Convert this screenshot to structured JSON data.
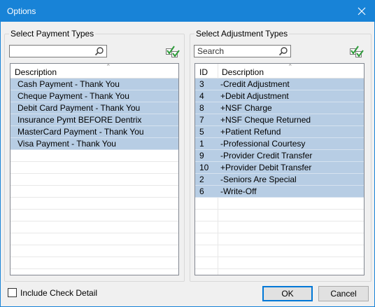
{
  "window": {
    "title": "Options"
  },
  "payment": {
    "group_label": "Select Payment Types",
    "search_value": "",
    "search_placeholder": "",
    "columns": [
      "Description"
    ],
    "rows": [
      {
        "description": "Cash Payment - Thank You",
        "selected": true
      },
      {
        "description": "Cheque Payment - Thank You",
        "selected": true
      },
      {
        "description": "Debit Card Payment - Thank You",
        "selected": true
      },
      {
        "description": "Insurance Pymt BEFORE Dentrix",
        "selected": true
      },
      {
        "description": "MasterCard Payment - Thank You",
        "selected": true
      },
      {
        "description": "Visa Payment - Thank You",
        "selected": true
      }
    ]
  },
  "adjustment": {
    "group_label": "Select Adjustment Types",
    "search_value": "",
    "search_placeholder": "Search",
    "columns": [
      "ID",
      "Description"
    ],
    "rows": [
      {
        "id": "3",
        "description": "-Credit Adjustment",
        "selected": true
      },
      {
        "id": "4",
        "description": "+Debit Adjustment",
        "selected": true
      },
      {
        "id": "8",
        "description": "+NSF Charge",
        "selected": true
      },
      {
        "id": "7",
        "description": "+NSF Cheque Returned",
        "selected": true
      },
      {
        "id": "5",
        "description": "+Patient Refund",
        "selected": true
      },
      {
        "id": "1",
        "description": "-Professional Courtesy",
        "selected": true
      },
      {
        "id": "9",
        "description": "-Provider Credit Transfer",
        "selected": true
      },
      {
        "id": "10",
        "description": "+Provider Debit Transfer",
        "selected": true
      },
      {
        "id": "2",
        "description": "-Seniors Are Special",
        "selected": true
      },
      {
        "id": "6",
        "description": "-Write-Off",
        "selected": true
      }
    ]
  },
  "include_check_detail": {
    "label": "Include Check Detail",
    "checked": false
  },
  "buttons": {
    "ok": "OK",
    "cancel": "Cancel"
  },
  "colors": {
    "accent": "#1883d7",
    "selection": "#b7cde4",
    "check_green": "#2e9b3a"
  }
}
